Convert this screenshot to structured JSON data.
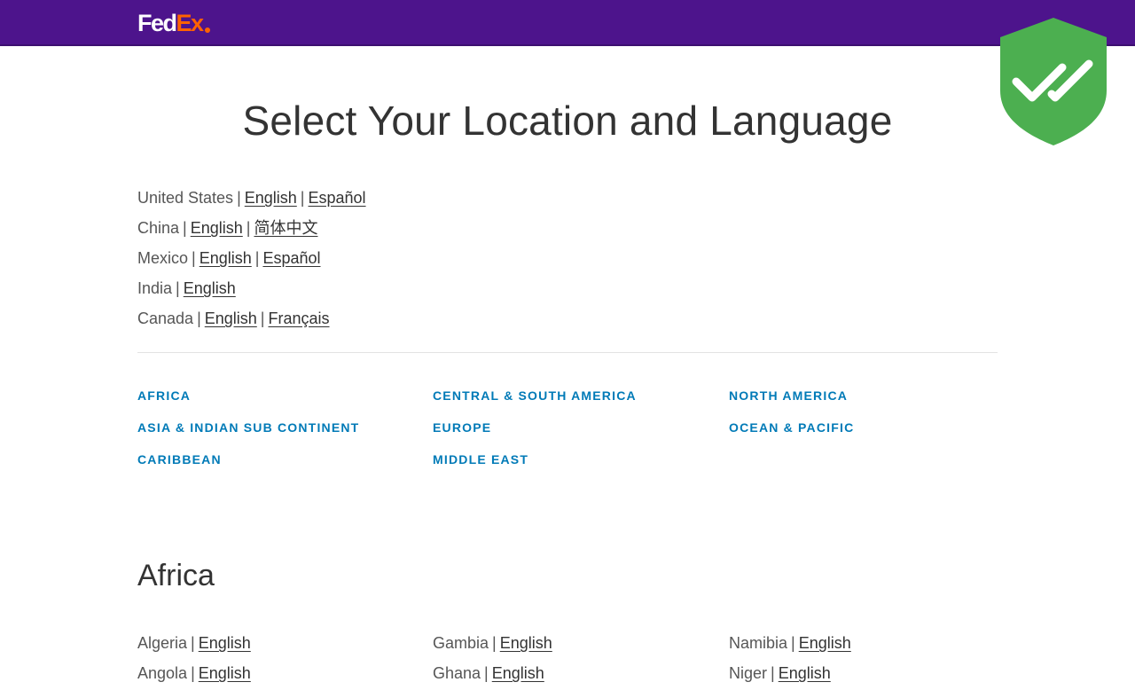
{
  "header": {
    "logo_fed": "Fed",
    "logo_ex": "Ex",
    "brand_color": "#4d148c",
    "accent_color": "#ff6200",
    "badge_icon": "shield-check-icon",
    "badge_color": "#4caf50"
  },
  "page": {
    "title": "Select Your Location and Language"
  },
  "featured_locations": [
    {
      "country": "United States",
      "languages": [
        "English",
        "Español"
      ]
    },
    {
      "country": "China",
      "languages": [
        "English",
        "简体中文"
      ]
    },
    {
      "country": "Mexico",
      "languages": [
        "English",
        "Español"
      ]
    },
    {
      "country": "India",
      "languages": [
        "English"
      ]
    },
    {
      "country": "Canada",
      "languages": [
        "English",
        "Français"
      ]
    }
  ],
  "regions": {
    "link_color": "#007ab7",
    "items": [
      "AFRICA",
      "ASIA & INDIAN SUB CONTINENT",
      "CARIBBEAN",
      "CENTRAL & SOUTH AMERICA",
      "EUROPE",
      "MIDDLE EAST",
      "NORTH AMERICA",
      "OCEAN & PACIFIC"
    ]
  },
  "africa": {
    "heading": "Africa",
    "countries": [
      {
        "country": "Algeria",
        "languages": [
          "English"
        ]
      },
      {
        "country": "Angola",
        "languages": [
          "English"
        ]
      },
      {
        "country": "Gambia",
        "languages": [
          "English"
        ]
      },
      {
        "country": "Ghana",
        "languages": [
          "English"
        ]
      },
      {
        "country": "Namibia",
        "languages": [
          "English"
        ]
      },
      {
        "country": "Niger",
        "languages": [
          "English"
        ]
      }
    ]
  },
  "separator": "|"
}
